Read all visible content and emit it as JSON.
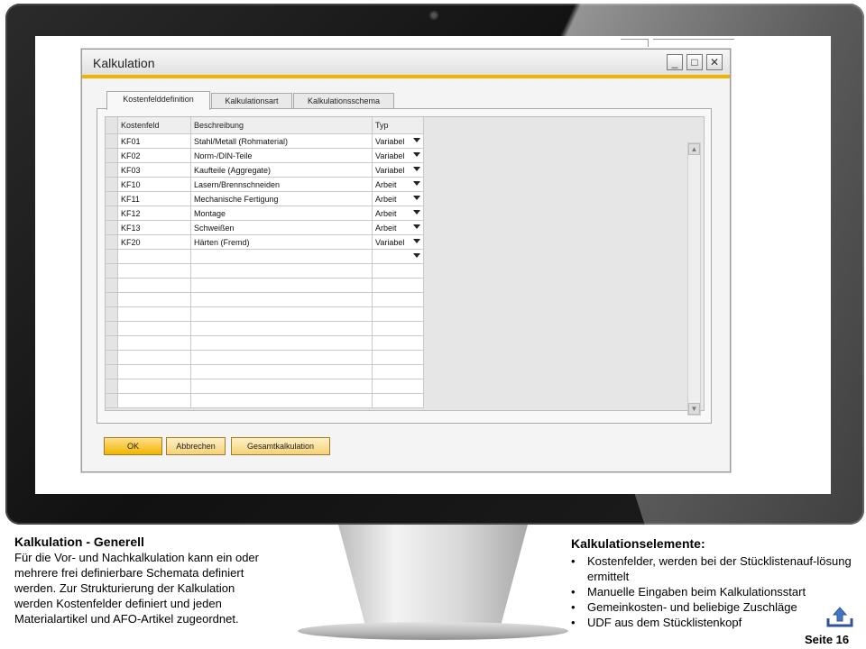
{
  "window": {
    "title": "Kalkulation",
    "controls": {
      "minimize": "_",
      "maximize": "□",
      "close": "✕"
    }
  },
  "tabs": [
    {
      "label": "Kostenfelddefinition",
      "active": true
    },
    {
      "label": "Kalkulationsart",
      "active": false
    },
    {
      "label": "Kalkulationsschema",
      "active": false
    }
  ],
  "grid": {
    "columns": [
      "Kostenfeld",
      "Beschreibung",
      "Typ"
    ],
    "rows": [
      {
        "kostenfeld": "KF01",
        "beschreibung": "Stahl/Metall (Rohmaterial)",
        "typ": "Variabel"
      },
      {
        "kostenfeld": "KF02",
        "beschreibung": "Norm-/DIN-Teile",
        "typ": "Variabel"
      },
      {
        "kostenfeld": "KF03",
        "beschreibung": "Kaufteile (Aggregate)",
        "typ": "Variabel"
      },
      {
        "kostenfeld": "KF10",
        "beschreibung": "Lasern/Brennschneiden",
        "typ": "Arbeit"
      },
      {
        "kostenfeld": "KF11",
        "beschreibung": "Mechanische Fertigung",
        "typ": "Arbeit"
      },
      {
        "kostenfeld": "KF12",
        "beschreibung": "Montage",
        "typ": "Arbeit"
      },
      {
        "kostenfeld": "KF13",
        "beschreibung": "Schweißen",
        "typ": "Arbeit"
      },
      {
        "kostenfeld": "KF20",
        "beschreibung": "Härten (Fremd)",
        "typ": "Variabel"
      }
    ],
    "empty_rows": 11
  },
  "buttons": {
    "ok": "OK",
    "cancel": "Abbrechen",
    "total": "Gesamtkalkulation"
  },
  "left": {
    "heading": "Kalkulation - Generell",
    "lines": [
      "Für die Vor- und Nachkalkulation kann ein oder",
      "mehrere frei definierbare Schemata definiert",
      "werden. Zur Strukturierung der Kalkulation",
      "werden Kostenfelder definiert und jeden",
      "Materialartikel und AFO-Artikel zugeordnet."
    ]
  },
  "right": {
    "heading": "Kalkulationselemente:",
    "bullets": [
      "Kostenfelder, werden bei der Stücklistenauf-lösung ermittelt",
      "Manuelle Eingaben beim Kalkulationsstart",
      "Gemeinkosten- und beliebige Zuschläge",
      "UDF aus dem Stücklistenkopf"
    ]
  },
  "footer": {
    "page": "Seite 16"
  },
  "colors": {
    "accent": "#f2b400",
    "bezel": "#1a1a1a"
  }
}
